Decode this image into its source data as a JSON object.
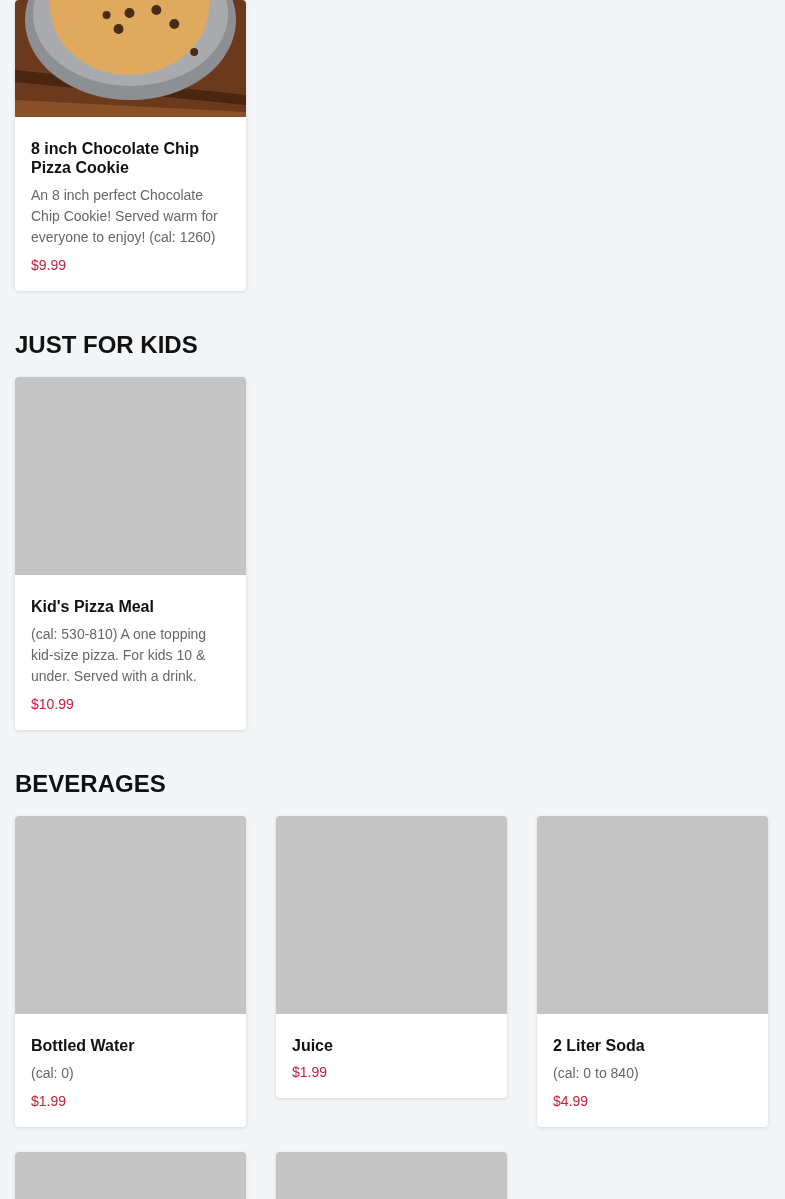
{
  "sections": [
    {
      "items": [
        {
          "title": "8 inch Chocolate Chip Pizza Cookie",
          "description": "An 8 inch perfect Chocolate Chip Cookie! Served warm for everyone to enjoy! (cal: 1260)",
          "price": "$9.99"
        }
      ]
    },
    {
      "heading": "JUST FOR KIDS",
      "items": [
        {
          "kind": "placeholder",
          "title": "Kid's Pizza Meal",
          "description": "(cal: 530-810) A one topping kid-size pizza. For kids 10 & under. Served with a drink.",
          "price": "$10.99"
        }
      ]
    },
    {
      "heading": "BEVERAGES",
      "items": [
        {
          "kind": "placeholder",
          "title": "Bottled Water",
          "description": "(cal: 0)",
          "price": "$1.99"
        },
        {
          "kind": "placeholder",
          "title": "Juice",
          "price": "$1.99"
        },
        {
          "kind": "placeholder",
          "title": "2 Liter Soda",
          "description": "(cal: 0 to 840)",
          "price": "$4.99"
        },
        {
          "kind": "placeholder"
        },
        {
          "kind": "placeholder"
        }
      ]
    }
  ]
}
